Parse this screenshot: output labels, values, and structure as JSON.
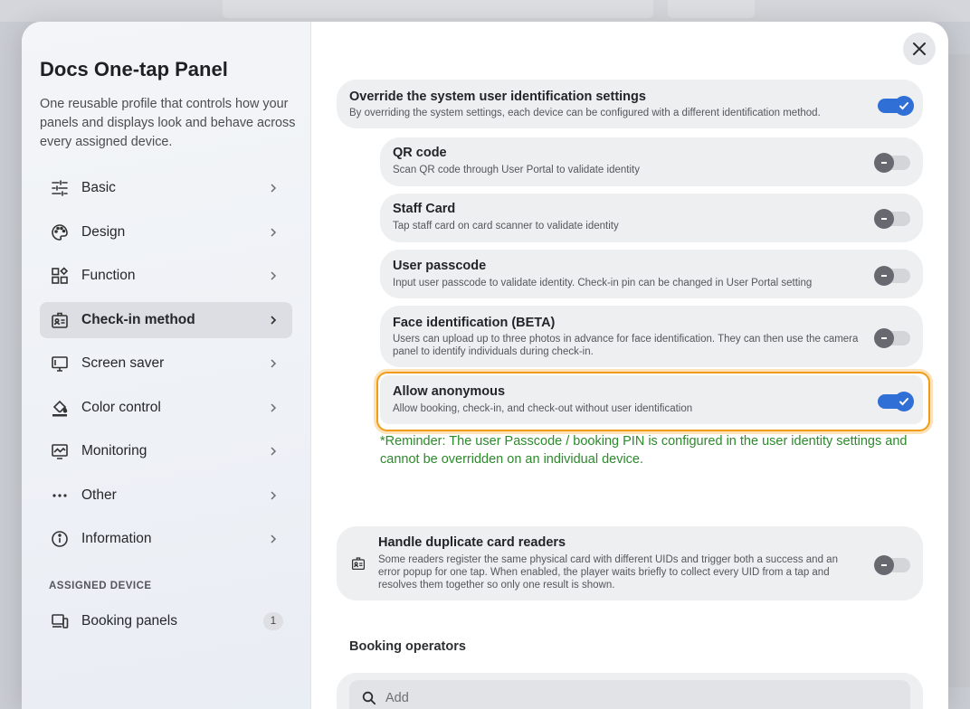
{
  "sidebar": {
    "title": "Docs One-tap Panel",
    "description": "One reusable profile that controls how your panels and displays look and behave across every assigned device.",
    "items": [
      {
        "label": "Basic",
        "icon": "sliders-icon"
      },
      {
        "label": "Design",
        "icon": "palette-icon"
      },
      {
        "label": "Function",
        "icon": "widgets-icon"
      },
      {
        "label": "Check-in method",
        "icon": "id-badge-icon",
        "active": true
      },
      {
        "label": "Screen saver",
        "icon": "monitor-icon"
      },
      {
        "label": "Color control",
        "icon": "paint-bucket-icon"
      },
      {
        "label": "Monitoring",
        "icon": "chart-monitor-icon"
      },
      {
        "label": "Other",
        "icon": "more-dots-icon"
      },
      {
        "label": "Information",
        "icon": "info-icon"
      }
    ],
    "assigned_section": "ASSIGNED DEVICE",
    "assigned": {
      "label": "Booking panels",
      "count": "1",
      "icon": "devices-icon"
    }
  },
  "main": {
    "override": {
      "title": "Override the system user identification settings",
      "subtitle": "By overriding the system settings, each device can be configured with a different identification method.",
      "enabled": true
    },
    "methods": [
      {
        "title": "QR code",
        "subtitle": "Scan QR code through User Portal to validate identity",
        "enabled": false
      },
      {
        "title": "Staff Card",
        "subtitle": "Tap staff card on card scanner to validate identity",
        "enabled": false
      },
      {
        "title": "User passcode",
        "subtitle": "Input user passcode to validate identity. Check-in pin can be changed in User Portal setting",
        "enabled": false
      },
      {
        "title": "Face identification (BETA)",
        "subtitle": "Users can upload up to three photos in advance for face identification. They can then use the camera panel to identify individuals during check-in.",
        "enabled": false
      },
      {
        "title": "Allow anonymous",
        "subtitle": "Allow booking, check-in, and check-out without user identification",
        "enabled": true
      }
    ],
    "reminder": "*Reminder: The user Passcode / booking PIN is configured in the user identity settings and cannot be overridden on an individual device.",
    "duplicate": {
      "title": "Handle duplicate card readers",
      "subtitle": "Some readers register the same physical card with different UIDs and trigger both a success and an error popup for one tap. When enabled, the player waits briefly to collect every UID from a tap and resolves them together so only one result is shown.",
      "enabled": false
    },
    "operators_label": "Booking operators",
    "search_placeholder": "Add"
  },
  "colors": {
    "accent": "#2f6fd6",
    "highlight": "#f39a16",
    "reminder": "#2c8a2c"
  }
}
